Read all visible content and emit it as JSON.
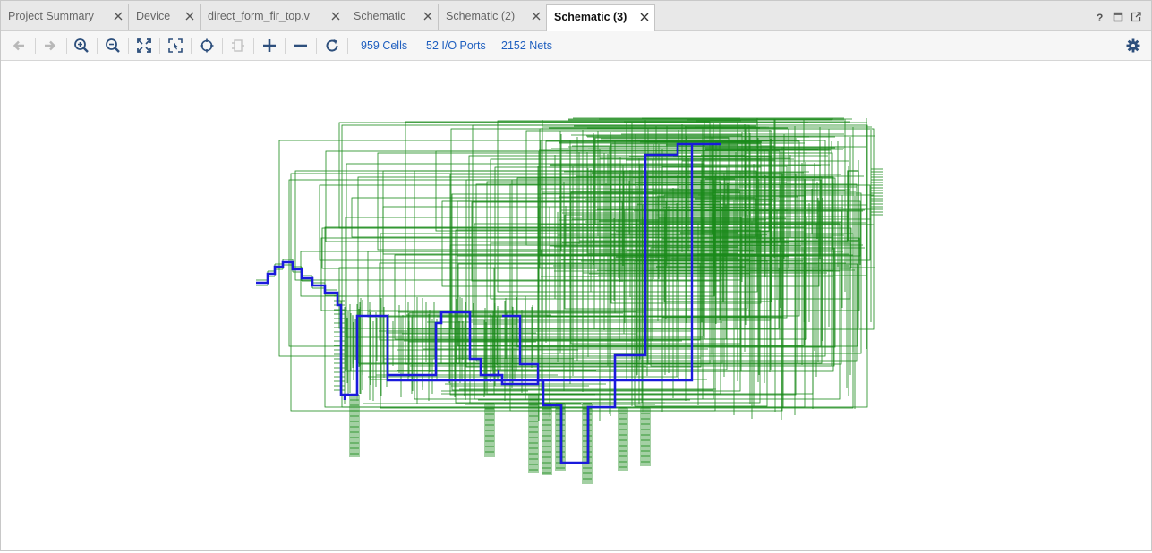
{
  "tabs": [
    {
      "label": "Project Summary"
    },
    {
      "label": "Device"
    },
    {
      "label": "direct_form_fir_top.v"
    },
    {
      "label": "Schematic"
    },
    {
      "label": "Schematic (2)"
    },
    {
      "label": "Schematic (3)"
    }
  ],
  "window_controls": {
    "icons": [
      "help-icon",
      "maximize-icon",
      "float-icon"
    ]
  },
  "toolbar": {
    "stats": {
      "cells": "959 Cells",
      "ports": "52 I/O Ports",
      "nets": "2152 Nets"
    },
    "buttons": [
      "back-icon",
      "forward-icon",
      "zoom-in-icon",
      "zoom-out-icon",
      "fit-icon",
      "zoom-area-icon",
      "select-icon",
      "cell-icon",
      "expand-icon",
      "collapse-icon",
      "refresh-icon",
      "gear-icon"
    ]
  },
  "colors": {
    "net": "#1a8a1a",
    "highlight_net": "#1a1adc",
    "accent": "#1f5fbf"
  }
}
